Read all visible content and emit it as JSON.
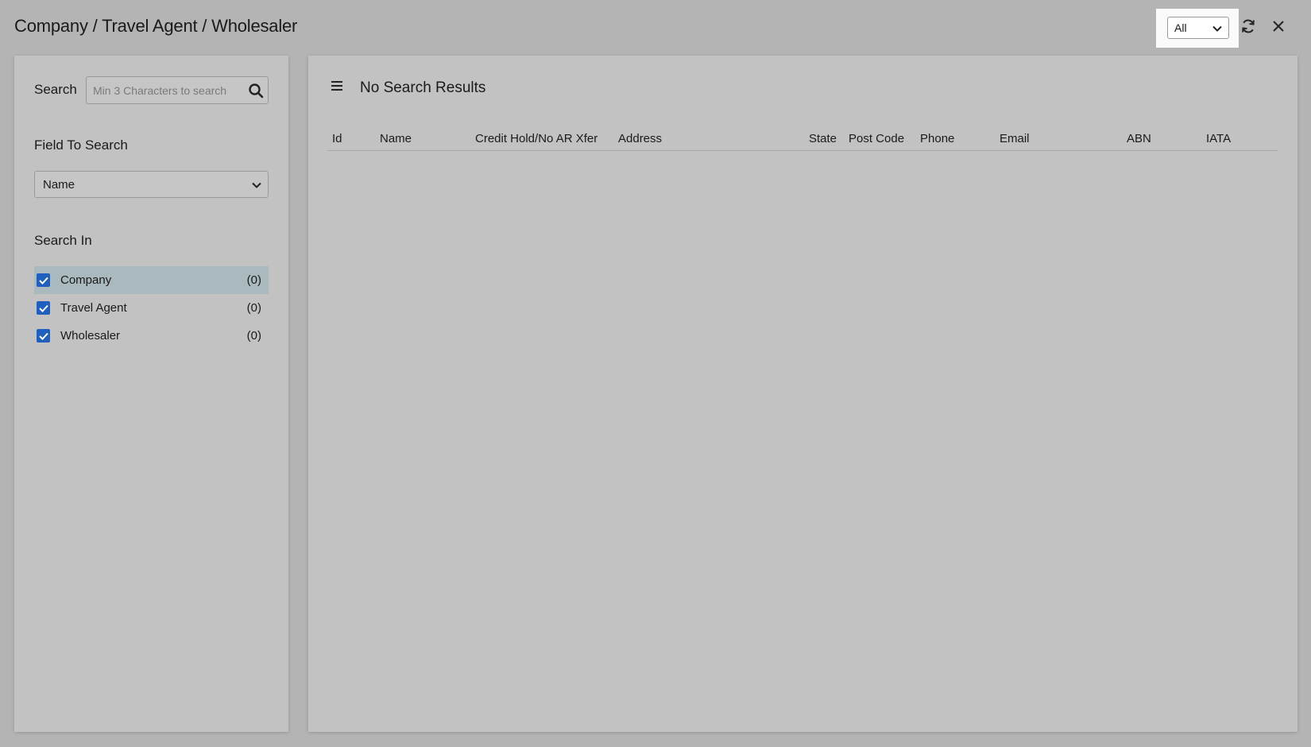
{
  "header": {
    "title": "Company / Travel Agent / Wholesaler",
    "filter_value": "All"
  },
  "left_panel": {
    "search_label": "Search",
    "search_placeholder": "Min 3 Characters to search",
    "field_label": "Field To Search",
    "field_value": "Name",
    "search_in_label": "Search In",
    "options": [
      {
        "label": "Company",
        "count": "(0)",
        "checked": true
      },
      {
        "label": "Travel Agent",
        "count": "(0)",
        "checked": true
      },
      {
        "label": "Wholesaler",
        "count": "(0)",
        "checked": true
      }
    ]
  },
  "results": {
    "title": "No Search Results",
    "columns": [
      "Id",
      "Name",
      "Credit Hold/No AR Xfer",
      "Address",
      "State",
      "Post Code",
      "Phone",
      "Email",
      "ABN",
      "IATA"
    ]
  },
  "colors": {
    "background": "#b4b4b4",
    "panel": "#c2c2c2",
    "checkbox": "#1f5fbf",
    "active_row": "#a9b9bd"
  },
  "icons": [
    "refresh-icon",
    "close-icon",
    "search-icon",
    "menu-icon",
    "chevron-down-icon",
    "checkmark-icon"
  ]
}
